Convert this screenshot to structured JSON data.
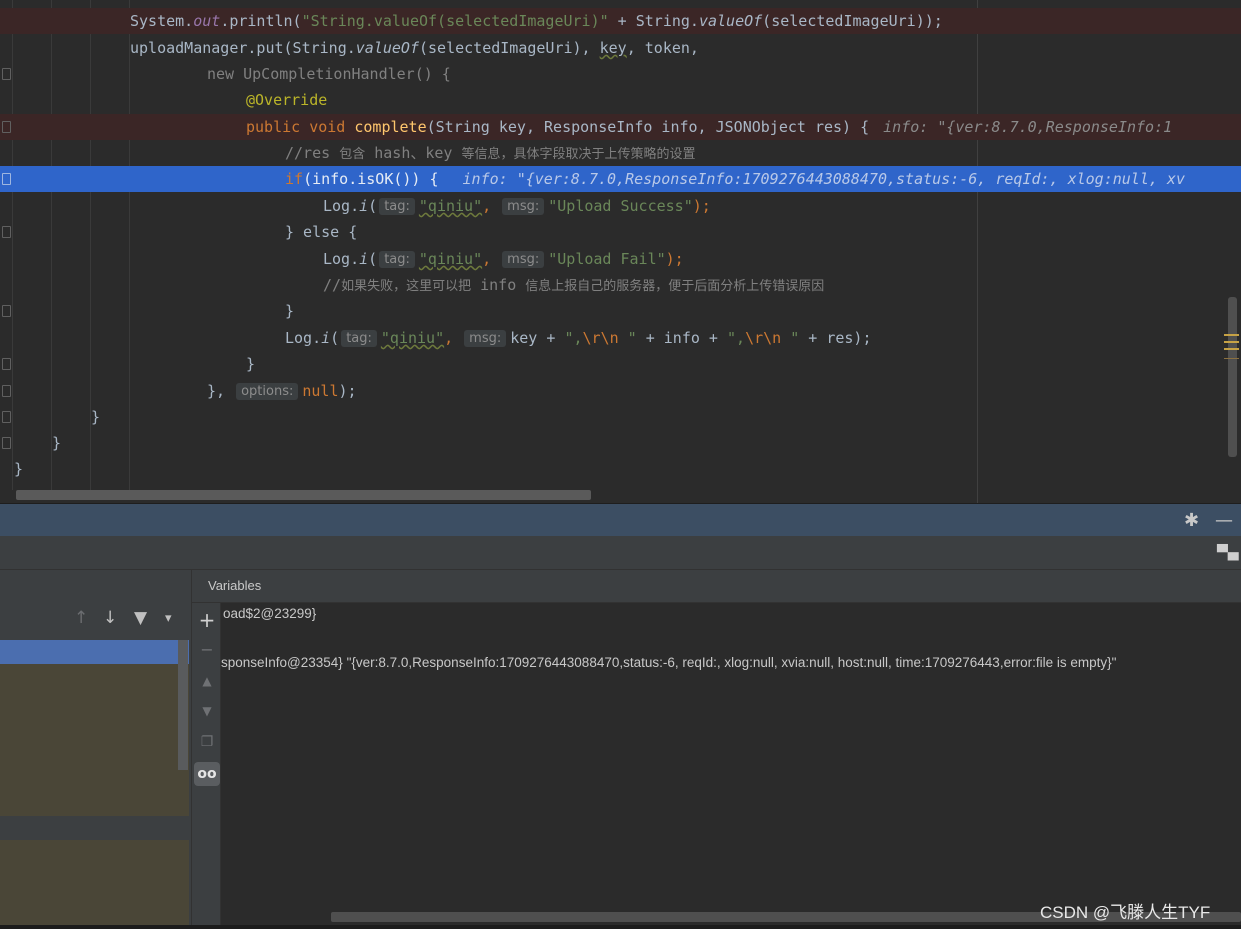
{
  "editor": {
    "lines": {
      "l1_a": "System.",
      "l1_b": "out",
      "l1_c": ".println(",
      "l1_str": "\"String.valueOf(selectedImageUri)\"",
      "l1_d": " + String.",
      "l1_e": "valueOf",
      "l1_f": "(selectedImageUri));",
      "l2_a": "uploadManager.put(String.",
      "l2_b": "valueOf",
      "l2_c": "(selectedImageUri), ",
      "l2_key": "key",
      "l2_d": ", token,",
      "l3": "new UpCompletionHandler() {",
      "l4": "@Override",
      "l5_kw": "public void ",
      "l5_fn": "complete",
      "l5_b": "(String key, ResponseInfo info, JSONObject res) {",
      "l5_ann": "info: \"{ver:8.7.0,ResponseInfo:1",
      "l6_a": "//res ",
      "l6_b": "包含",
      "l6_c": " hash、key ",
      "l6_d": "等信息，具体字段取决于上传策略的设置",
      "l7_kw": "if",
      "l7_b": "(info.isOK()) {",
      "l7_ann": "info: \"{ver:8.7.0,ResponseInfo:1709276443088470,status:-6, reqId:, xlog:null, xv",
      "l8_a": "Log.",
      "l8_b": "i",
      "l8_c": "(",
      "l8_tag": "tag:",
      "l8_s1": "\"qiniu\"",
      "l8_comma": ",",
      "l8_msg": "msg:",
      "l8_s2": "\"Upload Success\"",
      "l8_end": ");",
      "l9": "} else {",
      "l10_a": "Log.",
      "l10_b": "i",
      "l10_c": "(",
      "l10_tag": "tag:",
      "l10_s1": "\"qiniu\"",
      "l10_comma": ",",
      "l10_msg": "msg:",
      "l10_s2": "\"Upload Fail\"",
      "l10_end": ");",
      "l11_a": "//",
      "l11_b": "如果失败，这里可以把",
      "l11_c": " info ",
      "l11_d": "信息上报自己的服务器，便于后面分析上传错误原因",
      "l12": "}",
      "l13_a": "Log.",
      "l13_b": "i",
      "l13_c": "(",
      "l13_tag": "tag:",
      "l13_s1": "\"qiniu\"",
      "l13_comma": ",",
      "l13_msg": "msg:",
      "l13_d": "key + ",
      "l13_s2a": "\",",
      "l13_esc": "\\r\\n",
      "l13_s2b": " \"",
      "l13_e": " + info + ",
      "l13_s3a": "\",",
      "l13_s3b": " \"",
      "l13_f": " + res);",
      "l14": "}",
      "l15_a": "}, ",
      "l15_opt": "options:",
      "l15_null": "null",
      "l15_end": ");",
      "l16": "}",
      "l17": "}",
      "l18": "}"
    }
  },
  "tool_window": {
    "settings_icon": "✱",
    "minimize_icon": "—",
    "layout_icon": "▀▄",
    "frames_toolbar": {
      "up": "↑",
      "down": "↓",
      "filter": "▼",
      "menu": "▾"
    },
    "side_buttons": {
      "add": "+",
      "remove": "−",
      "up": "▲",
      "down": "▼",
      "copy": "❐",
      "watch": "oo"
    },
    "variables_title": "Variables",
    "rows": [
      {
        "text": "oad$2@23299}"
      },
      {
        "text": "sponseInfo@23354}",
        "value": "\"{ver:8.7.0,ResponseInfo:1709276443088470,status:-6, reqId:, xlog:null, xvia:null, host:null, time:1709276443,error:file is empty}\""
      }
    ]
  },
  "watermark": "CSDN @飞滕人生TYF"
}
